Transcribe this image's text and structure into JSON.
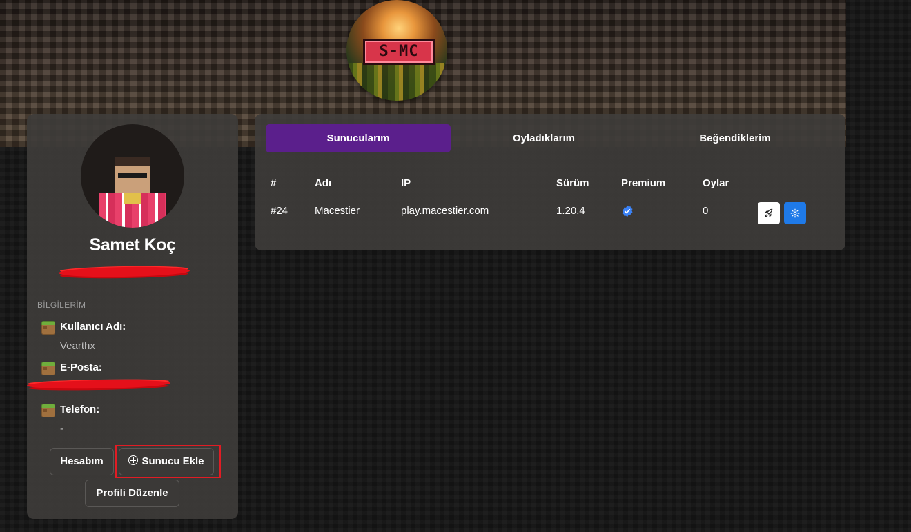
{
  "logo": {
    "text": "S-MC"
  },
  "profile": {
    "name": "Samet Koç",
    "section_label": "BİLGİLERİM",
    "info": [
      {
        "title": "Kullanıcı Adı:",
        "value": "Vearthx"
      },
      {
        "title": "E-Posta:",
        "value": ""
      },
      {
        "title": "Telefon:",
        "value": "-"
      }
    ],
    "buttons": {
      "account": "Hesabım",
      "add_server": "Sunucu Ekle",
      "edit_profile": "Profili Düzenle"
    }
  },
  "tabs": [
    {
      "label": "Sunucularım",
      "active": true
    },
    {
      "label": "Oyladıklarım",
      "active": false
    },
    {
      "label": "Beğendiklerim",
      "active": false
    }
  ],
  "table": {
    "headers": [
      "#",
      "Adı",
      "IP",
      "Sürüm",
      "Premium",
      "Oylar"
    ],
    "rows": [
      {
        "id": "#24",
        "name": "Macestier",
        "ip": "play.macestier.com",
        "version": "1.20.4",
        "premium": true,
        "votes": "0"
      }
    ]
  },
  "colors": {
    "tab_active": "#5b1f8c",
    "accent_blue": "#1f7ae8",
    "highlight_red": "#e11c24"
  },
  "icons": [
    "verified-icon",
    "rocket-icon",
    "gear-icon",
    "plus-circle-icon",
    "grass-block-icon"
  ]
}
